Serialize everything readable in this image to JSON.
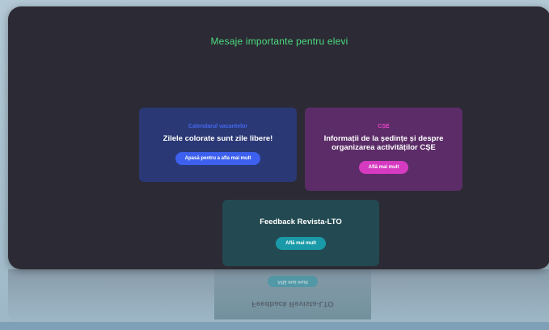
{
  "page": {
    "title": "Mesaje importante pentru elevi"
  },
  "cards": [
    {
      "eyebrow": "Calendarul vacantelor",
      "heading": "Zilele colorate sunt zile libere!",
      "button": "Apasă pentru a afla mai mult",
      "accent": "#3d61ee"
    },
    {
      "eyebrow": "CȘE",
      "heading_line1": "Informații de la ședințe și despre",
      "heading_line2": "organizarea activităților CȘE",
      "button": "Află mai mult",
      "accent": "#d53ac0"
    },
    {
      "heading": "Feedback Revista-LTO",
      "button": "Află mai mult",
      "accent": "#1a9aa8"
    }
  ],
  "colors": {
    "background": "#b4c9d6",
    "panel": "#2c2a34",
    "title": "#4bdc7f"
  }
}
